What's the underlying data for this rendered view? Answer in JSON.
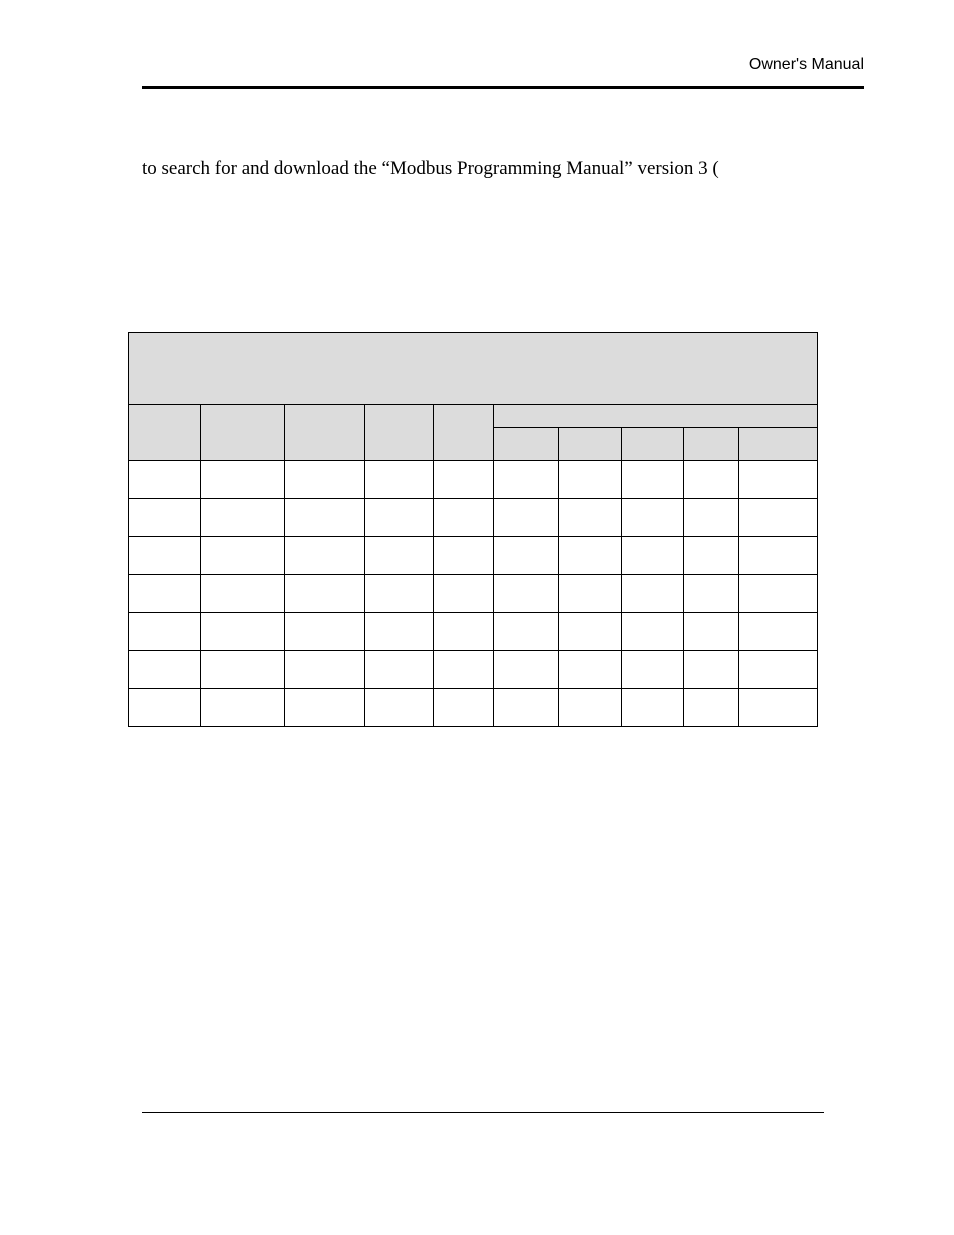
{
  "header": {
    "right_text": "Owner's Manual"
  },
  "body": {
    "line1": "to search for and download the “Modbus Programming Manual” version 3 ("
  },
  "chart_data": {
    "type": "table",
    "title": "",
    "columns": 10,
    "header_rows": [
      {
        "cells": [
          ""
        ],
        "colspan": 10
      },
      {
        "cells": [
          "",
          "",
          "",
          "",
          "",
          ""
        ],
        "colspans": [
          1,
          1,
          1,
          1,
          1,
          5
        ]
      },
      {
        "cells": [
          "",
          "",
          "",
          "",
          "",
          "",
          "",
          "",
          "",
          ""
        ]
      }
    ],
    "data_rows": [
      [
        "",
        "",
        "",
        "",
        "",
        "",
        "",
        "",
        "",
        ""
      ],
      [
        "",
        "",
        "",
        "",
        "",
        "",
        "",
        "",
        "",
        ""
      ],
      [
        "",
        "",
        "",
        "",
        "",
        "",
        "",
        "",
        "",
        ""
      ],
      [
        "",
        "",
        "",
        "",
        "",
        "",
        "",
        "",
        "",
        ""
      ],
      [
        "",
        "",
        "",
        "",
        "",
        "",
        "",
        "",
        "",
        ""
      ],
      [
        "",
        "",
        "",
        "",
        "",
        "",
        "",
        "",
        "",
        ""
      ],
      [
        "",
        "",
        "",
        "",
        "",
        "",
        "",
        "",
        "",
        ""
      ]
    ]
  }
}
